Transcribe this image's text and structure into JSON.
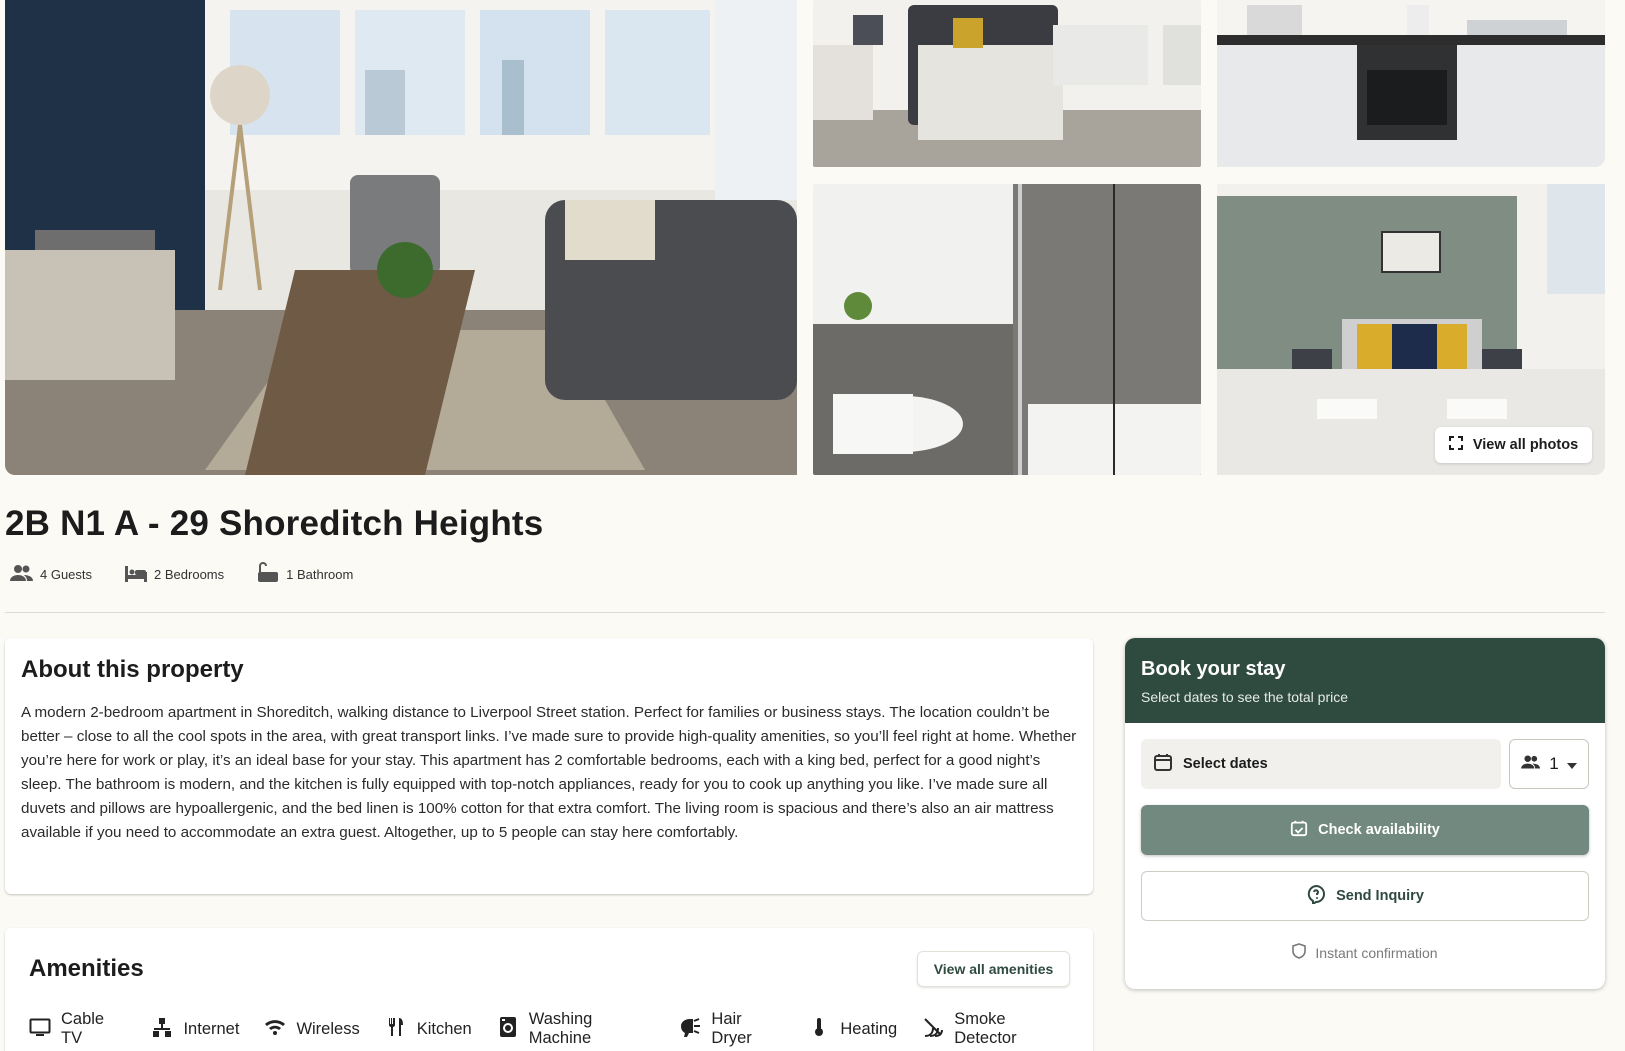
{
  "gallery": {
    "photos": [
      {
        "icon": "living-room-photo"
      },
      {
        "icon": "bedroom-photo"
      },
      {
        "icon": "kitchen-photo"
      },
      {
        "icon": "bathroom-photo"
      },
      {
        "icon": "master-bedroom-photo"
      }
    ],
    "view_all_label": "View all photos"
  },
  "property": {
    "title": "2B N1 A - 29 Shoreditch Heights",
    "specs": {
      "guests": "4 Guests",
      "bedrooms": "2 Bedrooms",
      "bathrooms": "1 Bathroom"
    }
  },
  "about": {
    "heading": "About this property",
    "text": "A modern 2-bedroom apartment in Shoreditch, walking distance to Liverpool Street station. Perfect for families or business stays. The location couldn’t be better – close to all the cool spots in the area, with great transport links. I’ve made sure to provide high-quality amenities, so you’ll feel right at home. Whether you’re here for work or play, it’s an ideal base for your stay. This apartment has 2 comfortable bedrooms, each with a king bed, perfect for a good night’s sleep. The bathroom is modern, and the kitchen is fully equipped with top-notch appliances, ready for you to cook up anything you like. I’ve made sure all duvets and pillows are hypoallergenic, and the bed linen is 100% cotton for that extra comfort. The living room is spacious and there’s also an air mattress available if you need to accommodate an extra guest. Altogether, up to 5 people can stay here comfortably."
  },
  "amenities": {
    "heading": "Amenities",
    "view_all_label": "View all amenities",
    "items": [
      {
        "label": "Cable TV",
        "icon": "tv-icon"
      },
      {
        "label": "Internet",
        "icon": "network-icon"
      },
      {
        "label": "Wireless",
        "icon": "wifi-icon"
      },
      {
        "label": "Kitchen",
        "icon": "utensils-icon"
      },
      {
        "label": "Washing Machine",
        "icon": "washer-icon"
      },
      {
        "label": "Hair Dryer",
        "icon": "hair-dryer-icon"
      },
      {
        "label": "Heating",
        "icon": "thermometer-icon"
      },
      {
        "label": "Smoke Detector",
        "icon": "smoke-detector-icon"
      }
    ]
  },
  "booking": {
    "title": "Book your stay",
    "subtitle": "Select dates to see the total price",
    "dates_label": "Select dates",
    "guests_value": "1",
    "check_label": "Check availability",
    "inquiry_label": "Send Inquiry",
    "instant_label": "Instant confirmation"
  },
  "colors": {
    "brand": "#2f4a3f",
    "check_button": "#72897f",
    "background": "#fbfaf5"
  }
}
